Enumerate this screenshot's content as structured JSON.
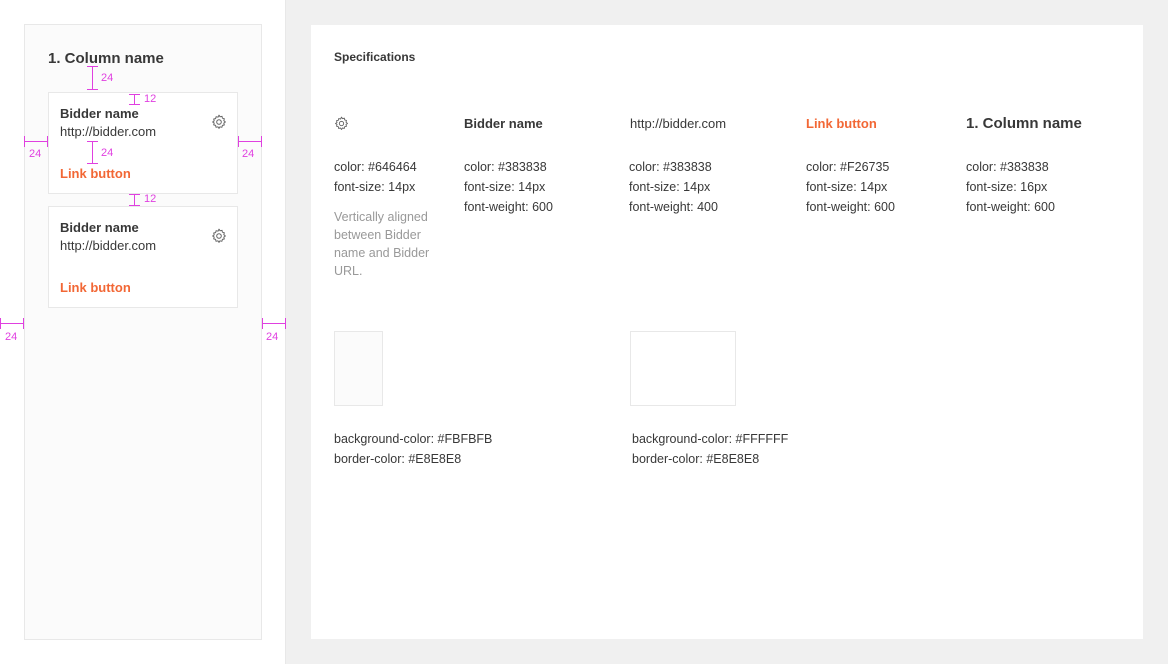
{
  "column": {
    "title": "1. Column name",
    "cards": [
      {
        "name": "Bidder name",
        "url": "http://bidder.com",
        "link": "Link button",
        "gear_icon": "gear-icon"
      },
      {
        "name": "Bidder name",
        "url": "http://bidder.com",
        "link": "Link button",
        "gear_icon": "gear-icon"
      }
    ]
  },
  "measurements": {
    "title_gap": "24",
    "card_pad_top": "12",
    "card_left": "24",
    "card_right": "24",
    "card_inner": "24",
    "card_gap": "12",
    "col_left": "24",
    "col_right": "24"
  },
  "specs": {
    "title": "Specifications",
    "gear": {
      "icon": "gear-icon",
      "color": "color: #646464",
      "size": "font-size: 14px",
      "note": "Vertically aligned between Bidder name and Bidder URL."
    },
    "bidder_name": {
      "sample": "Bidder name",
      "color": "color: #383838",
      "size": "font-size: 14px",
      "weight": "font-weight: 600"
    },
    "bidder_url": {
      "sample": "http://bidder.com",
      "color": "color: #383838",
      "size": "font-size: 14px",
      "weight": "font-weight: 400"
    },
    "link_button": {
      "sample": "Link button",
      "color": "color: #F26735",
      "size": "font-size: 14px",
      "weight": "font-weight: 600"
    },
    "column_name": {
      "sample": "1. Column name",
      "color": "color: #383838",
      "size": "font-size: 16px",
      "weight": "font-weight: 600"
    },
    "column_swatch": {
      "bg": "background-color: #FBFBFB",
      "border": "border-color: #E8E8E8"
    },
    "card_swatch": {
      "bg": "background-color: #FFFFFF",
      "border": "border-color: #E8E8E8"
    }
  },
  "colors": {
    "accent": "#F26735",
    "measure": "#E040E0",
    "text": "#383838",
    "icon": "#646464"
  }
}
